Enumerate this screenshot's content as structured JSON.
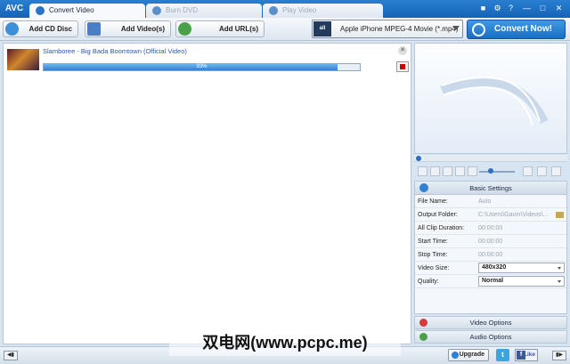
{
  "app": {
    "logo": "AVC"
  },
  "tabs": [
    {
      "label": "Convert Video",
      "active": true
    },
    {
      "label": "Burn DVD",
      "active": false
    },
    {
      "label": "Play Video",
      "active": false
    }
  ],
  "window_controls": {
    "skin": "shirt-icon",
    "settings": "gear-icon",
    "help": "?",
    "minimize": "—",
    "maximize": "□",
    "close": "✕"
  },
  "toolbar": {
    "add_cd_label": "Add CD Disc",
    "add_video_label": "Add Video(s)",
    "add_url_label": "Add URL(s)",
    "format_icon_text": "all",
    "format_label": "Apple iPhone MPEG-4 Movie (*.mp4)",
    "convert_label": "Convert Now!"
  },
  "file": {
    "title": "Slamboree - Big Bada Boomtown (Official Video)",
    "progress_text": "93%",
    "progress": 0.93
  },
  "settings": {
    "header": "Basic Settings",
    "rows": [
      {
        "label": "File Name:",
        "value": "Auto"
      },
      {
        "label": "Output Folder:",
        "value": "C:\\Users\\Gavin\\Videos\\..."
      },
      {
        "label": "All Clip Duration:",
        "value": "00:00:00"
      },
      {
        "label": "Start Time:",
        "value": "00:00:00"
      },
      {
        "label": "Stop Time:",
        "value": "00:00:00"
      },
      {
        "label": "Video Size:",
        "value": "480x320"
      },
      {
        "label": "Quality:",
        "value": "Normal"
      }
    ]
  },
  "options": {
    "video": "Video Options",
    "audio": "Audio Options"
  },
  "statusbar": {
    "upgrade": "Upgrade",
    "twitter": "t",
    "fb_f": "f",
    "fb_like": "Like"
  },
  "watermark": "双电网(www.pcpc.me)",
  "colors": {
    "accent": "#1f6fc5",
    "progress": "#3a8ae0",
    "stop": "#cc0000"
  }
}
